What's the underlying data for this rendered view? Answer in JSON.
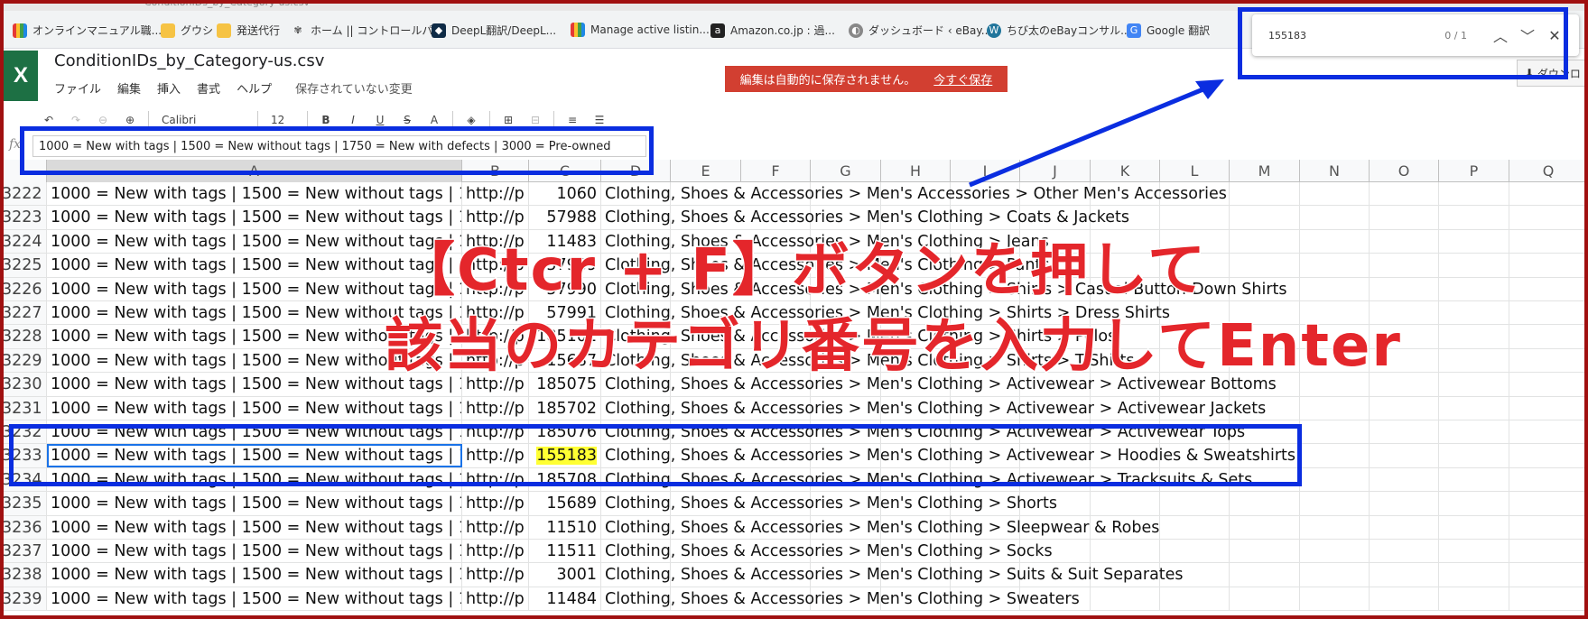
{
  "browser": {
    "url_fragment": "ConditionIDs_by_Category-us.csv",
    "bookmarks": [
      {
        "label": "オンラインマニュアル職...",
        "icon": "colorful-icon"
      },
      {
        "label": "グウシ",
        "icon": "folder-icon"
      },
      {
        "label": "発送代行",
        "icon": "folder-icon"
      },
      {
        "label": "ホーム || コントロールパ...",
        "icon": "sprout-icon"
      },
      {
        "label": "DeepL翻訳/DeepL...",
        "icon": "deepl-icon"
      },
      {
        "label": "Manage active listin...",
        "icon": "listing-icon"
      },
      {
        "label": "Amazon.co.jp : 過...",
        "icon": "amazon-icon"
      },
      {
        "label": "ダッシュボード ‹ eBay...",
        "icon": "dashboard-icon"
      },
      {
        "label": "ちび太のeBayコンサル...",
        "icon": "wordpress-icon"
      },
      {
        "label": "Google 翻訳",
        "icon": "google-translate-icon"
      }
    ]
  },
  "find": {
    "query": "155183",
    "count": "0 / 1",
    "up_glyph": "︿",
    "down_glyph": "﹀",
    "close_glyph": "✕"
  },
  "app": {
    "logo": "X",
    "title": "ConditionIDs_by_Category-us.csv",
    "menu": [
      "ファイル",
      "編集",
      "挿入",
      "書式",
      "ヘルプ"
    ],
    "unsaved_label": "保存されていない変更",
    "banner_text": "編集は自動的に保存されません。",
    "banner_link": "今すぐ保存",
    "download_label": "ダウンロ"
  },
  "toolbar": {
    "font": "Calibri",
    "size": "12",
    "bold": "B",
    "italic": "I",
    "underline": "U",
    "strike": "S",
    "fontcolor": "A"
  },
  "formula": {
    "fx": "fx",
    "value": "1000 = New with tags | 1500 = New without tags | 1750 = New with defects | 3000 = Pre-owned"
  },
  "columns": [
    "A",
    "B",
    "C",
    "D",
    "E",
    "F",
    "G",
    "H",
    "I",
    "J",
    "K",
    "L",
    "M",
    "N",
    "O",
    "P",
    "Q"
  ],
  "rows": [
    {
      "n": "3222",
      "a": "1000 = New with tags | 1500 = New without tags | 1",
      "b": "http://p",
      "c": "1060",
      "d": "Clothing, Shoes & Accessories > Men's Accessories > Other Men's Accessories"
    },
    {
      "n": "3223",
      "a": "1000 = New with tags | 1500 = New without tags | 1",
      "b": "http://p",
      "c": "57988",
      "d": "Clothing, Shoes & Accessories > Men's Clothing > Coats & Jackets"
    },
    {
      "n": "3224",
      "a": "1000 = New with tags | 1500 = New without tags | 1",
      "b": "http://p",
      "c": "11483",
      "d": "Clothing, Shoes & Accessories > Men's Clothing > Jeans"
    },
    {
      "n": "3225",
      "a": "1000 = New with tags | 1500 = New without tags | 1",
      "b": "http://p",
      "c": "57989",
      "d": "Clothing, Shoes & Accessories > Men's Clothing > Pants"
    },
    {
      "n": "3226",
      "a": "1000 = New with tags | 1500 = New without tags | 1",
      "b": "http://p",
      "c": "57990",
      "d": "Clothing, Shoes & Accessories > Men's Clothing > Shirts > Casual Button-Down Shirts"
    },
    {
      "n": "3227",
      "a": "1000 = New with tags | 1500 = New without tags | 1",
      "b": "http://p",
      "c": "57991",
      "d": "Clothing, Shoes & Accessories > Men's Clothing > Shirts > Dress Shirts"
    },
    {
      "n": "3228",
      "a": "1000 = New with tags | 1500 = New without tags | 1",
      "b": "http://p",
      "c": "185101",
      "d": "Clothing, Shoes & Accessories > Men's Clothing > Shirts > Polos"
    },
    {
      "n": "3229",
      "a": "1000 = New with tags | 1500 = New without tags | 1",
      "b": "http://p",
      "c": "15687",
      "d": "Clothing, Shoes & Accessories > Men's Clothing > Shirts > T-Shirts"
    },
    {
      "n": "3230",
      "a": "1000 = New with tags | 1500 = New without tags | 1",
      "b": "http://p",
      "c": "185075",
      "d": "Clothing, Shoes & Accessories > Men's Clothing > Activewear > Activewear Bottoms"
    },
    {
      "n": "3231",
      "a": "1000 = New with tags | 1500 = New without tags | 1",
      "b": "http://p",
      "c": "185702",
      "d": "Clothing, Shoes & Accessories > Men's Clothing > Activewear > Activewear Jackets"
    },
    {
      "n": "3232",
      "a": "1000 = New with tags | 1500 = New without tags | 1",
      "b": "http://p",
      "c": "185076",
      "d": "Clothing, Shoes & Accessories > Men's Clothing > Activewear > Activewear Tops"
    },
    {
      "n": "3233",
      "a": "1000 = New with tags | 1500 = New without tags | 1",
      "b": "http://p",
      "c": "155183",
      "d": "Clothing, Shoes & Accessories > Men's Clothing > Activewear > Hoodies & Sweatshirts"
    },
    {
      "n": "3234",
      "a": "1000 = New with tags | 1500 = New without tags | 1",
      "b": "http://p",
      "c": "185708",
      "d": "Clothing, Shoes & Accessories > Men's Clothing > Activewear > Tracksuits & Sets"
    },
    {
      "n": "3235",
      "a": "1000 = New with tags | 1500 = New without tags | 1",
      "b": "http://p",
      "c": "15689",
      "d": "Clothing, Shoes & Accessories > Men's Clothing > Shorts"
    },
    {
      "n": "3236",
      "a": "1000 = New with tags | 1500 = New without tags | 1",
      "b": "http://p",
      "c": "11510",
      "d": "Clothing, Shoes & Accessories > Men's Clothing > Sleepwear & Robes"
    },
    {
      "n": "3237",
      "a": "1000 = New with tags | 1500 = New without tags | 1",
      "b": "http://p",
      "c": "11511",
      "d": "Clothing, Shoes & Accessories > Men's Clothing > Socks"
    },
    {
      "n": "3238",
      "a": "1000 = New with tags | 1500 = New without tags | 1",
      "b": "http://p",
      "c": "3001",
      "d": "Clothing, Shoes & Accessories > Men's Clothing > Suits & Suit Separates"
    },
    {
      "n": "3239",
      "a": "1000 = New with tags | 1500 = New without tags | 1",
      "b": "http://p",
      "c": "11484",
      "d": "Clothing, Shoes & Accessories > Men's Clothing > Sweaters"
    }
  ],
  "highlight_value": "155183",
  "active_row": "3233",
  "overlay": {
    "line1": "【Ctcr + F】ボタンを押して",
    "line2": "該当のカテゴリ番号を入力してEnter"
  },
  "colors": {
    "annotation": "#0a2de0",
    "overlay_text": "#e4262b",
    "highlight": "#ffff33",
    "banner": "#d23f31",
    "frame": "#a01010"
  }
}
